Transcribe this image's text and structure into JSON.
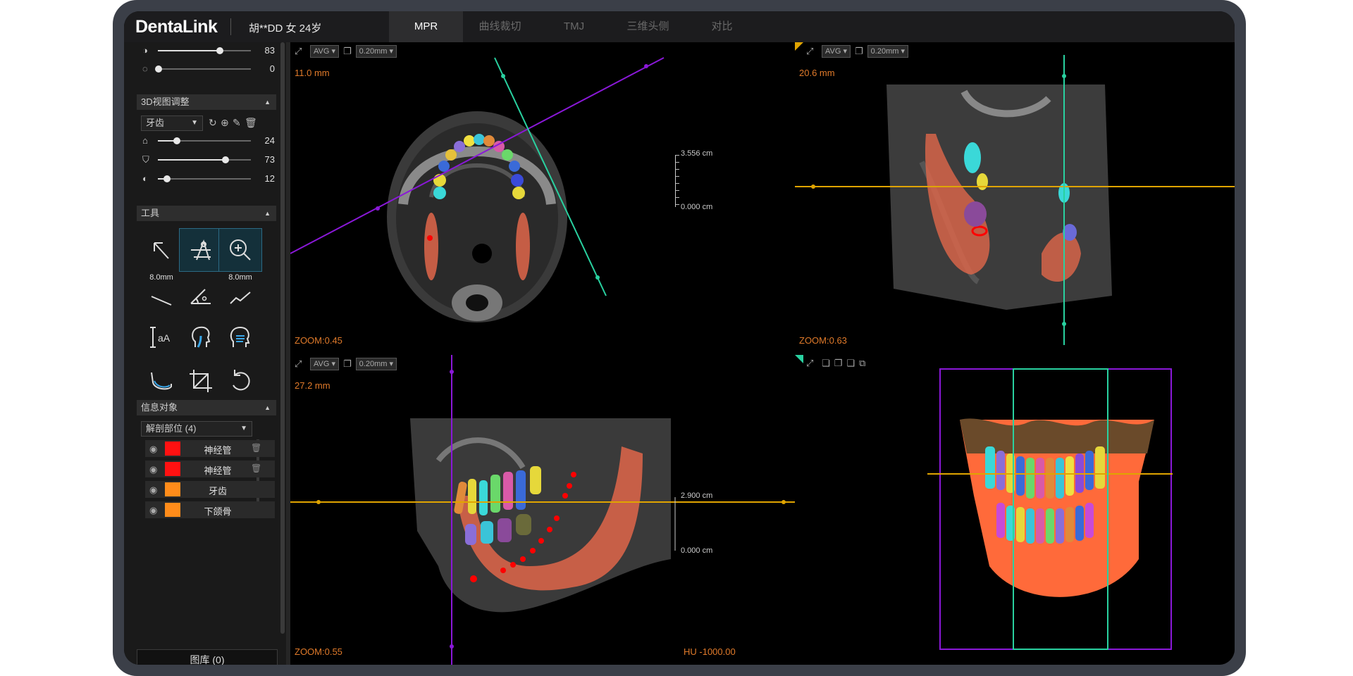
{
  "app": {
    "logo": "DentaLink",
    "patient": "胡**DD 女 24岁"
  },
  "tabs": [
    {
      "label": "MPR",
      "active": true
    },
    {
      "label": "曲线裁切",
      "active": false
    },
    {
      "label": "TMJ",
      "active": false
    },
    {
      "label": "三维头侧",
      "active": false
    },
    {
      "label": "对比",
      "active": false
    }
  ],
  "sidebar": {
    "top_sliders": [
      {
        "icon": "contrast-icon",
        "value": "83",
        "fraction": 0.66
      },
      {
        "icon": "brightness-icon",
        "value": "0",
        "fraction": 0.03
      }
    ],
    "view3d": {
      "title": "3D视图调整",
      "object_select": "牙齿",
      "sliders": [
        {
          "icon": "opacity-icon",
          "value": "24",
          "fraction": 0.2
        },
        {
          "icon": "threshold-icon",
          "value": "73",
          "fraction": 0.73
        },
        {
          "icon": "smooth-icon",
          "value": "12",
          "fraction": 0.1
        }
      ]
    },
    "tools": {
      "title": "工具",
      "distance_label": "8.0mm",
      "curve_label": "8.0mm"
    },
    "info": {
      "title": "信息对象",
      "select": "解剖部位 (4)",
      "layers": [
        {
          "name": "神经管",
          "color": "#ff1111",
          "deletable": true
        },
        {
          "name": "神经管",
          "color": "#ff1111",
          "deletable": true
        },
        {
          "name": "牙齿",
          "color": "#ff8c1a",
          "deletable": false
        },
        {
          "name": "下颌骨",
          "color": "#ff8c1a",
          "deletable": false
        }
      ]
    },
    "library_button": "图库 (0)"
  },
  "viewports": {
    "axial": {
      "mode": "AVG",
      "thickness": "0.20mm",
      "depth": "11.0 mm",
      "zoom": "ZOOM:0.45",
      "scale_top": "3.556 cm",
      "scale_bottom": "0.000 cm"
    },
    "coronal": {
      "mode": "AVG",
      "thickness": "0.20mm",
      "depth": "20.6 mm",
      "zoom": "ZOOM:0.63"
    },
    "sagittal": {
      "mode": "AVG",
      "thickness": "0.20mm",
      "depth": "27.2 mm",
      "zoom": "ZOOM:0.55",
      "scale_top": "2.900 cm",
      "scale_bottom": "0.000 cm",
      "hu": "HU -1000.00"
    }
  },
  "colors": {
    "accent_orange": "#e07a2a",
    "purple": "#8a18d8",
    "teal": "#29d1a0",
    "yellow": "#e0a400"
  }
}
